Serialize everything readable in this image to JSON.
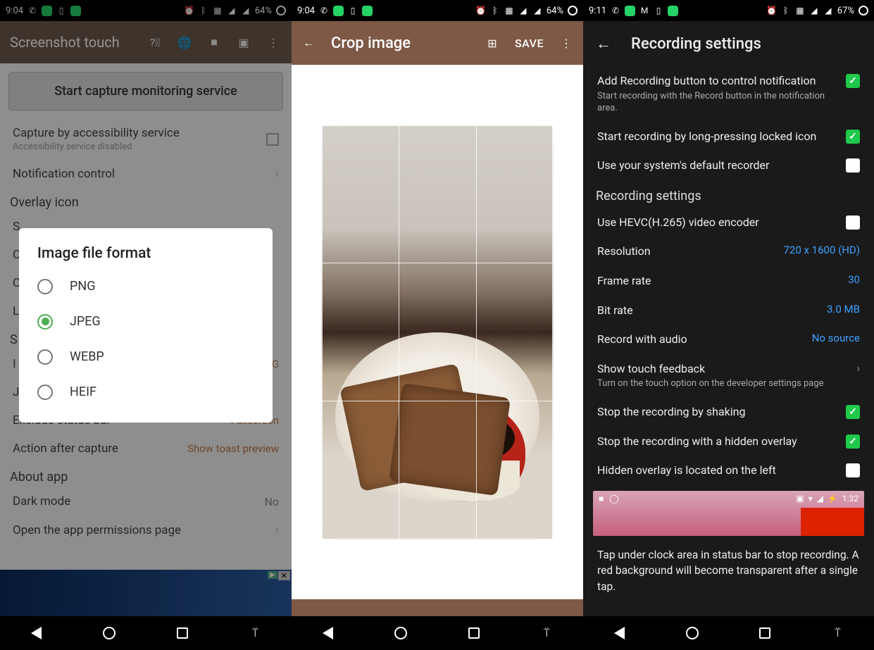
{
  "screen1": {
    "status_time": "9:04",
    "battery": "64%",
    "app_title": "Screenshot touch",
    "start_button": "Start capture monitoring service",
    "accessibility": {
      "title": "Capture by accessibility service",
      "sub": "Accessibility service disabled"
    },
    "notification_control": "Notification control",
    "overlay_header": "Overlay icon",
    "saving_s": "S",
    "exclude_status": {
      "label": "Exclude status bar",
      "value": "Fullscreen"
    },
    "action_after": {
      "label": "Action after capture",
      "value": "Show toast preview"
    },
    "about_header": "About app",
    "dark_mode": {
      "label": "Dark mode",
      "value": "No"
    },
    "open_perms": "Open the app permissions page",
    "dialog": {
      "title": "Image file format",
      "options": [
        "PNG",
        "JPEG",
        "WEBP",
        "HEIF"
      ],
      "selected": "JPEG"
    }
  },
  "screen2": {
    "status_time": "9:04",
    "battery": "64%",
    "title": "Crop image",
    "save": "SAVE"
  },
  "screen3": {
    "status_time": "9:11",
    "battery": "67%",
    "title": "Recording settings",
    "add_rec": {
      "title": "Add Recording button to control notification",
      "sub": "Start recording with the Record button in the notification area."
    },
    "longpress": "Start recording by long-pressing locked icon",
    "default_recorder": "Use your system's default recorder",
    "section": "Recording settings",
    "hevc": "Use HEVC(H.265) video encoder",
    "resolution": {
      "label": "Resolution",
      "value": "720 x 1600 (HD)"
    },
    "framerate": {
      "label": "Frame rate",
      "value": "30"
    },
    "bitrate": {
      "label": "Bit rate",
      "value": "3.0 MB"
    },
    "audio": {
      "label": "Record with audio",
      "value": "No source"
    },
    "touch": {
      "title": "Show touch feedback",
      "sub": "Turn on the touch option on the developer settings page"
    },
    "shake": "Stop the recording by shaking",
    "hidden_overlay": "Stop the recording with a hidden overlay",
    "hidden_left": "Hidden overlay is located on the left",
    "pink_time": "1:32",
    "help": "Tap under clock area in status bar to stop recording. A red background will become transparent after a single tap."
  }
}
